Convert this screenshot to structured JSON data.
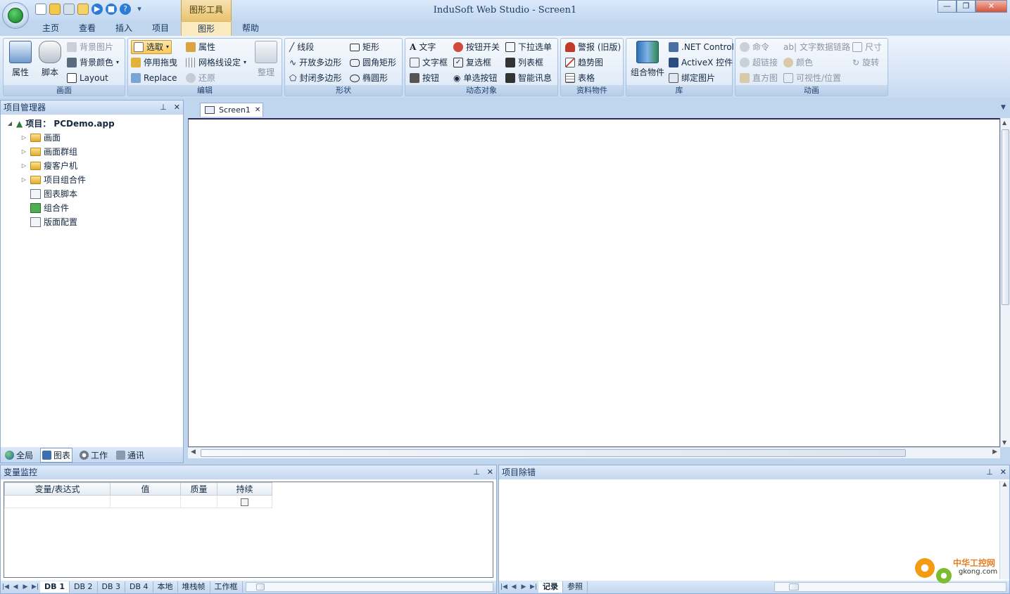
{
  "title_bar": {
    "window_title": "InduSoft Web Studio - Screen1",
    "context_tab": "图形工具",
    "quick_access": [
      "new-icon",
      "open-icon",
      "save-icon",
      "folder-icon",
      "run-icon",
      "stop-icon",
      "help-icon",
      "customize-icon"
    ]
  },
  "menu_tabs": [
    "主页",
    "查看",
    "插入",
    "项目",
    "图形",
    "帮助"
  ],
  "active_tab": "图形",
  "ribbon": {
    "screen": {
      "label": "画面",
      "properties": "属性",
      "script": "脚本",
      "bg_image": "背景图片",
      "bg_color": "背景颜色",
      "layout": "Layout"
    },
    "edit": {
      "label": "编辑",
      "select": "选取",
      "properties": "属性",
      "disable_drag": "停用拖曳",
      "grid": "网格线设定",
      "replace": "Replace",
      "undo": "还原",
      "arrange": "整理"
    },
    "shape": {
      "label": "形状",
      "line": "线段",
      "open_poly": "开放多边形",
      "closed_poly": "封闭多边形",
      "rect": "矩形",
      "round_rect": "圆角矩形",
      "ellipse": "椭圆形"
    },
    "dynamic": {
      "label": "动态对象",
      "text": "文字",
      "textbox": "文字框",
      "button": "按钮",
      "push_button": "按钮开关",
      "checkbox": "复选框",
      "radio": "单选按钮",
      "dropdown": "下拉选单",
      "listbox": "列表框",
      "smart_msg": "智能讯息"
    },
    "data": {
      "label": "资料物件",
      "alarm": "警报 (旧版)",
      "trend": "趋势图",
      "grid": "表格"
    },
    "library": {
      "label": "库",
      "symbol": "组合物件",
      "dotnet": ".NET Control",
      "activex": "ActiveX 控件",
      "linked_image": "绑定图片"
    },
    "animation": {
      "label": "动画",
      "command": "命令",
      "hyperlink": "超链接",
      "bargraph": "直方图",
      "text_data_link": "文字数据链路",
      "color": "颜色",
      "visibility": "可视性/位置",
      "size": "尺寸",
      "rotation": "旋转"
    }
  },
  "project_manager": {
    "title": "项目管理器",
    "root": "项目： PCDemo.app",
    "items": [
      "画面",
      "画面群组",
      "瘦客户机",
      "项目组合件",
      "图表脚本",
      "组合件",
      "版面配置"
    ],
    "tabs": [
      "全局",
      "图表",
      "工作",
      "通讯"
    ],
    "active_tab": "图表"
  },
  "document": {
    "tab": "Screen1"
  },
  "watch": {
    "title": "变量监控",
    "columns": [
      "变量/表达式",
      "值",
      "质量",
      "持续"
    ],
    "tabs": [
      "DB 1",
      "DB 2",
      "DB 3",
      "DB 4",
      "本地",
      "堆栈帧",
      "工作框"
    ],
    "active_tab": "DB 1"
  },
  "debug": {
    "title": "项目除错",
    "tabs": [
      "记录",
      "参照"
    ],
    "active_tab": "记录"
  },
  "watermark": {
    "name": "中华工控网",
    "site": "gkong.com"
  },
  "colors": {
    "accent": "#fbe9c0",
    "frame": "#bfd6ee",
    "panel_border": "#90aed3"
  }
}
